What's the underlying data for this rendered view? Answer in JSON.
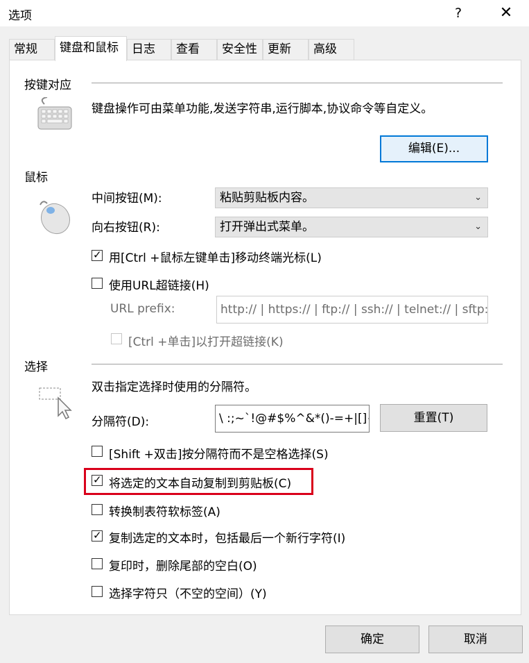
{
  "window": {
    "title": "选项",
    "help": "?",
    "close": "✕"
  },
  "tabs": [
    {
      "label": "常规"
    },
    {
      "label": "键盘和鼠标"
    },
    {
      "label": "日志"
    },
    {
      "label": "查看"
    },
    {
      "label": "安全性"
    },
    {
      "label": "更新"
    },
    {
      "label": "高级"
    }
  ],
  "keys": {
    "title": "按键对应",
    "desc": "键盘操作可由菜单功能,发送字符串,运行脚本,协议命令等自定义。",
    "edit_button": "编辑(E)..."
  },
  "mouse": {
    "title": "鼠标",
    "middle_label": "中间按钮(M):",
    "middle_value": "粘贴剪贴板内容。",
    "right_label": "向右按钮(R):",
    "right_value": "打开弹出式菜单。",
    "ctrl_click": {
      "label": "用[Ctrl +鼠标左键单击]移动终端光标(L)",
      "checked": true
    },
    "use_url": {
      "label": "使用URL超链接(H)",
      "checked": false
    },
    "url_prefix_label": "URL prefix:",
    "url_prefix_value": "http:// | https:// | ftp:// | ssh:// | telnet:// | sftp://",
    "ctrl_open": {
      "label": "[Ctrl +单击]以打开超链接(K)",
      "checked": false
    }
  },
  "selection": {
    "title": "选择",
    "desc": "双击指定选择时使用的分隔符。",
    "delim_label": "分隔符(D):",
    "delim_value": "\\ :;~`!@#$%^&*()-=+|[]{}",
    "reset_button": "重置(T)",
    "options": [
      {
        "label": "[Shift +双击]按分隔符而不是空格选择(S)",
        "checked": false
      },
      {
        "label": "将选定的文本自动复制到剪贴板(C)",
        "checked": true
      },
      {
        "label": "转换制表符软标签(A)",
        "checked": false
      },
      {
        "label": "复制选定的文本时，包括最后一个新行字符(I)",
        "checked": true
      },
      {
        "label": "复印时，删除尾部的空白(O)",
        "checked": false
      },
      {
        "label": "选择字符只（不空的空间）(Y)",
        "checked": false
      }
    ]
  },
  "footer": {
    "ok": "确定",
    "cancel": "取消"
  },
  "colors": {
    "accent": "#0078d7",
    "highlight": "#d9001b"
  }
}
